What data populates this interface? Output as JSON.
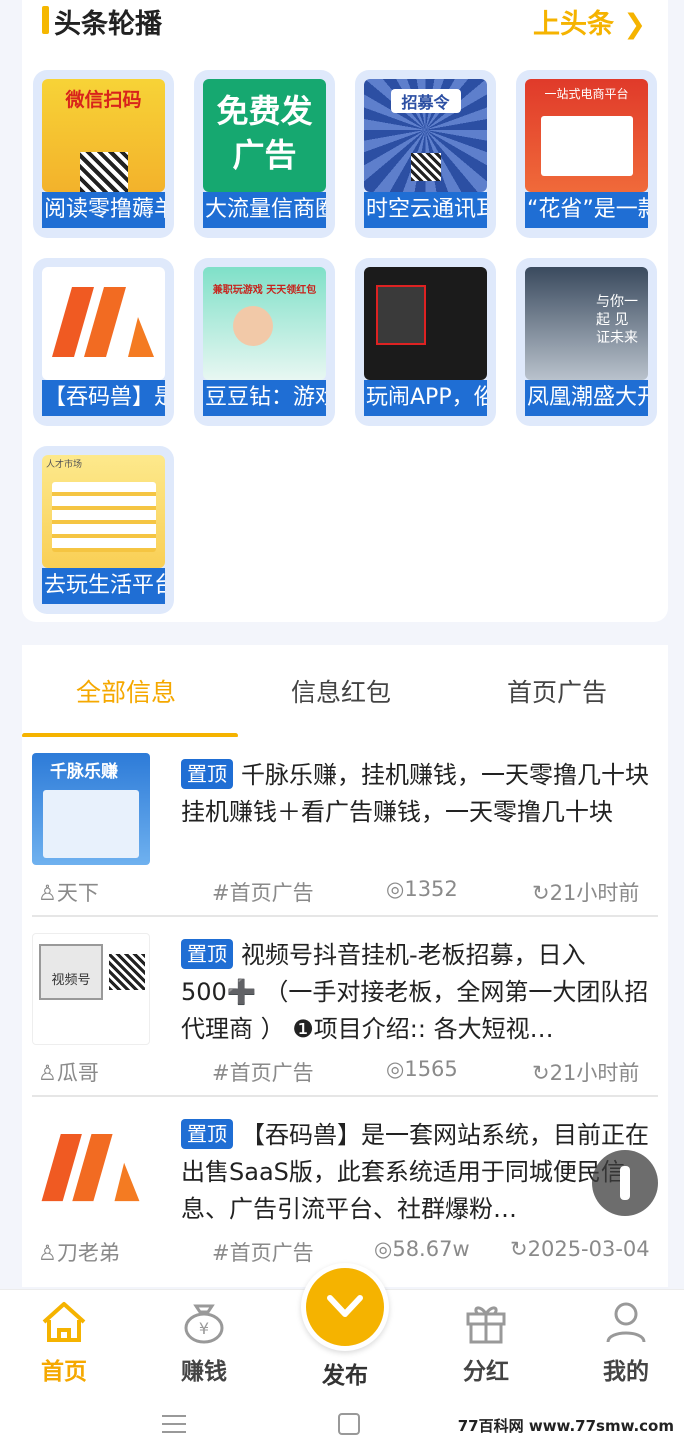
{
  "headline": {
    "title": "头条轮播",
    "more": "上头条",
    "tiles": [
      {
        "label": "阅读零撸薅羊",
        "img_text": "微信扫码"
      },
      {
        "label": "大流量信商圈",
        "img_text": "免费发广告"
      },
      {
        "label": "时空云通讯耳",
        "img_text": "招募令"
      },
      {
        "label": "“花省”是一款",
        "img_text": "一站式电商平台"
      },
      {
        "label": "【吞码兽】是",
        "img_text": ""
      },
      {
        "label": "豆豆钻：游戏",
        "img_text": "兼职玩游戏 天天领红包"
      },
      {
        "label": "玩闹APP，俗",
        "img_text": ""
      },
      {
        "label": "凤凰潮盛大开",
        "img_text": "与你一起 见证未来"
      },
      {
        "label": "去玩生活平台",
        "img_text": "人才市场"
      }
    ]
  },
  "tabs": {
    "items": [
      "全部信息",
      "信息红包",
      "首页广告"
    ],
    "active": 0
  },
  "list": {
    "items": [
      {
        "pin": "置顶",
        "text": "千脉乐赚，挂机赚钱，一天零撸几十块 挂机赚钱＋看广告赚钱，一天零撸几十块",
        "thumb_text": "千脉乐赚",
        "author": "天下",
        "tag": "#首页广告",
        "views": "1352",
        "time": "21小时前"
      },
      {
        "pin": "置顶",
        "text": "视频号抖音挂机-老板招募，日入500➕ （一手对接老板，全网第一大团队招代理商 ） ❶项目介绍:: 各大短视…",
        "thumb_text": "视频号",
        "author": "瓜哥",
        "tag": "#首页广告",
        "views": "1565",
        "time": "21小时前"
      },
      {
        "pin": "置顶",
        "text": "【吞码兽】是一套网站系统，目前正在出售SaaS版，此套系统适用于同城便民信息、广告引流平台、社群爆粉…",
        "thumb_text": "",
        "author": "刀老弟",
        "tag": "#首页广告",
        "views": "58.67w",
        "time": "2025-03-04"
      }
    ]
  },
  "nav": {
    "items": [
      "首页",
      "赚钱",
      "发布",
      "分红",
      "我的"
    ],
    "active": 0
  },
  "watermark": "77百科网 www.77smw.com",
  "colors": {
    "accent": "#f5b300",
    "pin_blue": "#1f6ed4"
  }
}
